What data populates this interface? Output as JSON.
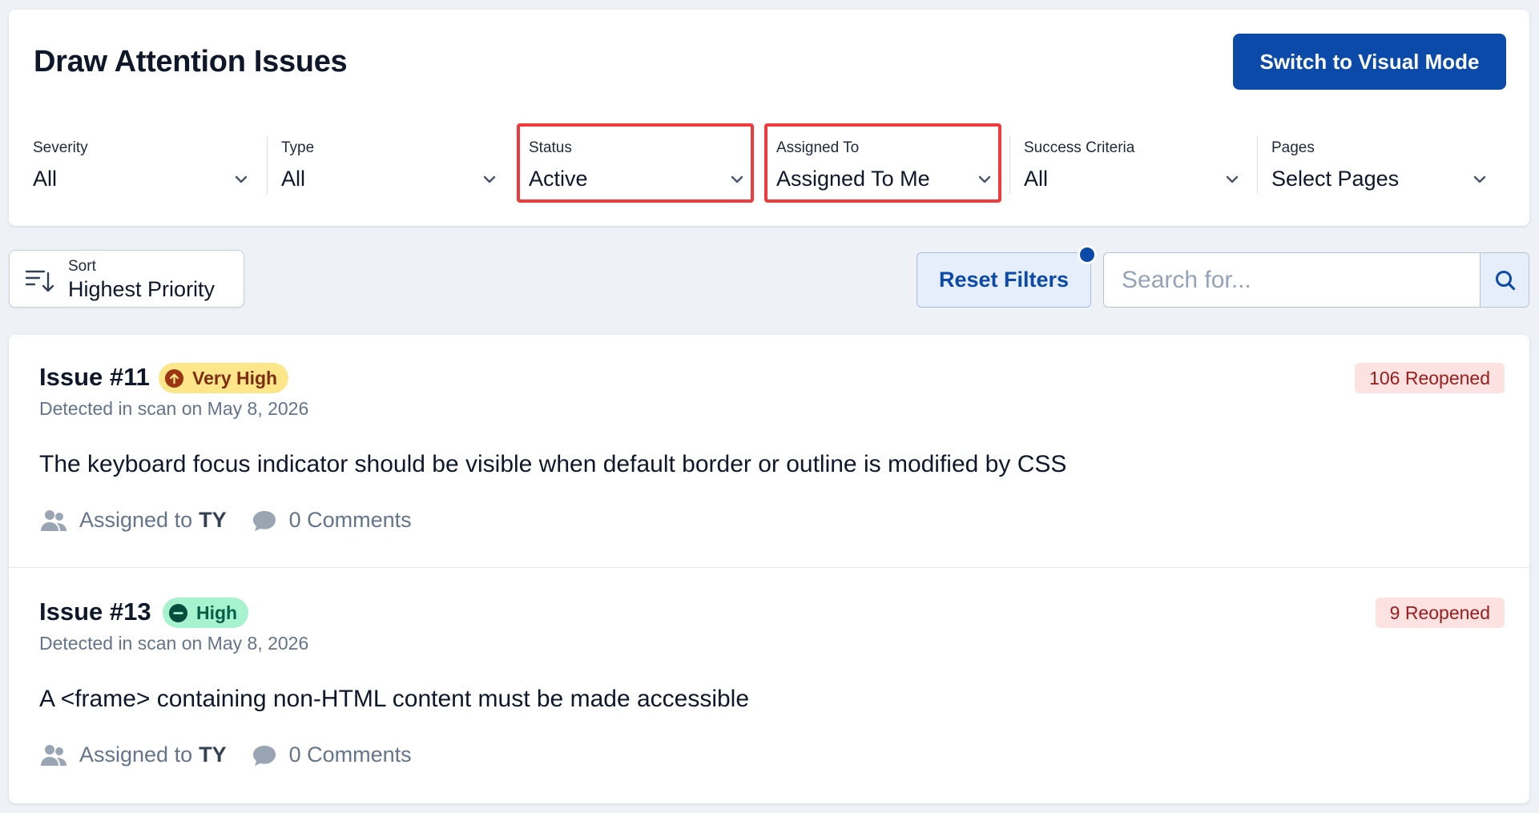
{
  "page": {
    "title": "Draw Attention Issues",
    "primary_action": "Switch to Visual Mode"
  },
  "filters": [
    {
      "label": "Severity",
      "value": "All"
    },
    {
      "label": "Type",
      "value": "All"
    },
    {
      "label": "Status",
      "value": "Active"
    },
    {
      "label": "Assigned To",
      "value": "Assigned To Me"
    },
    {
      "label": "Success Criteria",
      "value": "All"
    },
    {
      "label": "Pages",
      "value": "Select Pages"
    }
  ],
  "toolbar": {
    "sort_label": "Sort",
    "sort_value": "Highest Priority",
    "reset_label": "Reset Filters",
    "search_placeholder": "Search for..."
  },
  "issues": [
    {
      "title": "Issue #11",
      "severity": "Very High",
      "reopened": "106 Reopened",
      "detected": "Detected in scan on May 8, 2026",
      "description": "The keyboard focus indicator should be visible when default border or outline is modified by CSS",
      "assigned_prefix": "Assigned to",
      "assigned_to": "TY",
      "comments": "0 Comments"
    },
    {
      "title": "Issue #13",
      "severity": "High",
      "reopened": "9 Reopened",
      "detected": "Detected in scan on May 8, 2026",
      "description": "A <frame> containing non-HTML content must be made accessible",
      "assigned_prefix": "Assigned to",
      "assigned_to": "TY",
      "comments": "0 Comments"
    }
  ],
  "icons": {
    "chevron": "chevron-down-icon",
    "sort": "sort-icon",
    "search": "search-icon",
    "very_high": "arrow-up-circle-icon",
    "high": "minus-circle-icon",
    "users": "users-icon",
    "comment": "comment-icon"
  },
  "colors": {
    "primary": "#0b4aa8",
    "highlight": "#ef3b3b",
    "very_high_bg": "#fde68a",
    "high_bg": "#a7f3d0",
    "reopened_bg": "#fde2e2"
  }
}
